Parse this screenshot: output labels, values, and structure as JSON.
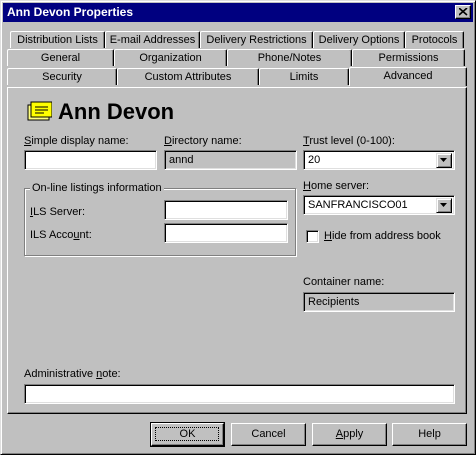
{
  "window": {
    "title": "Ann Devon Properties"
  },
  "tabs": {
    "row1": [
      "Distribution Lists",
      "E-mail Addresses",
      "Delivery Restrictions",
      "Delivery Options",
      "Protocols"
    ],
    "row2": [
      "General",
      "Organization",
      "Phone/Notes",
      "Permissions"
    ],
    "row3": [
      "Security",
      "Custom Attributes",
      "Limits",
      "Advanced"
    ],
    "active": "Advanced"
  },
  "header": {
    "display_name": "Ann Devon",
    "icon": "user-card-icon"
  },
  "fields": {
    "simple_display_name": {
      "label": "Simple display name:",
      "value": ""
    },
    "directory_name": {
      "label": "Directory name:",
      "value": "annd"
    },
    "trust_level": {
      "label": "Trust level (0-100):",
      "value": "20"
    },
    "home_server": {
      "label": "Home server:",
      "value": "SANFRANCISCO01"
    },
    "hide_from_address_book": {
      "label": "Hide from address book",
      "checked": false
    },
    "container_name": {
      "label": "Container name:",
      "value": "Recipients"
    },
    "administrative_note": {
      "label": "Administrative note:",
      "value": ""
    }
  },
  "online_listings": {
    "legend": "On-line listings information",
    "ils_server": {
      "label": "ILS Server:",
      "value": ""
    },
    "ils_account": {
      "label": "ILS Account:",
      "value": ""
    }
  },
  "buttons": {
    "ok": "OK",
    "cancel": "Cancel",
    "apply": "Apply",
    "help": "Help"
  },
  "colors": {
    "titlebar": "#000080",
    "face": "#c0c0c0"
  }
}
